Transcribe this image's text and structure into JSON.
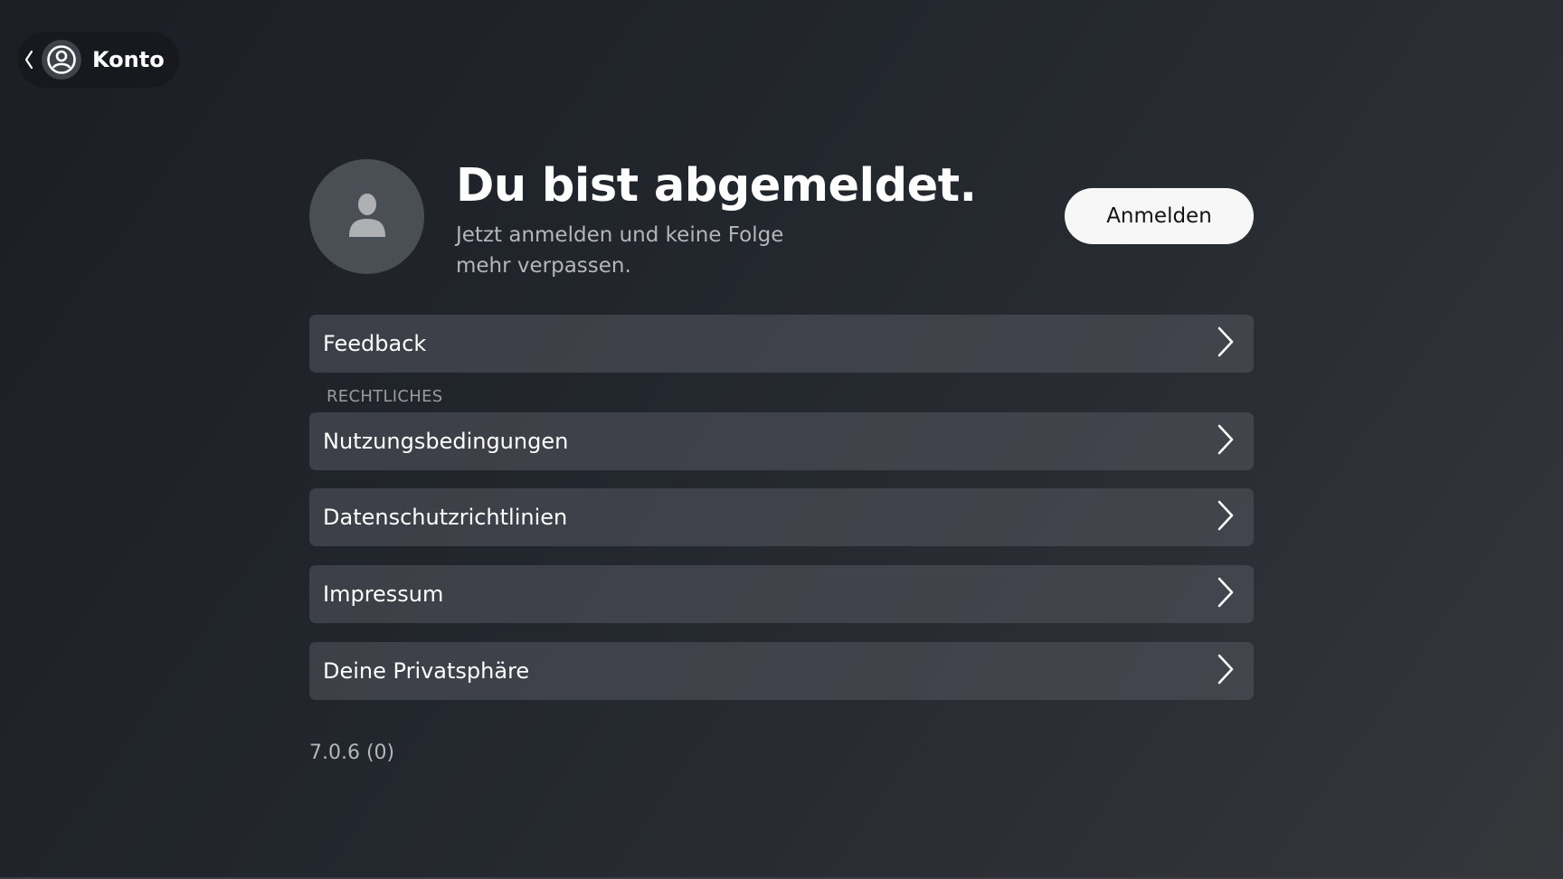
{
  "nav": {
    "title": "Konto",
    "back_icon": "back-chevron-icon",
    "account_icon": "user-circle-icon"
  },
  "profile": {
    "headline": "Du bist abgemeldet.",
    "subline": "Jetzt anmelden und keine Folge mehr verpassen.",
    "avatar_icon": "user-silhouette-icon",
    "signin_label": "Anmelden"
  },
  "menu": {
    "feedback": {
      "label": "Feedback",
      "icon": "chevron-right-icon"
    },
    "legal_section_label": "RECHTLICHES",
    "legal_items": [
      {
        "label": "Nutzungsbedingungen",
        "icon": "chevron-right-icon"
      },
      {
        "label": "Datenschutzrichtlinien",
        "icon": "chevron-right-icon"
      },
      {
        "label": "Impressum",
        "icon": "chevron-right-icon"
      },
      {
        "label": "Deine Privatsphäre",
        "icon": "chevron-right-icon"
      }
    ]
  },
  "footer": {
    "version": "7.0.6 (0)"
  },
  "colors": {
    "background": "#23272e",
    "row_background": "#44474e",
    "button_background": "#f7f7f7",
    "secondary_text": "#b4b6ba"
  }
}
